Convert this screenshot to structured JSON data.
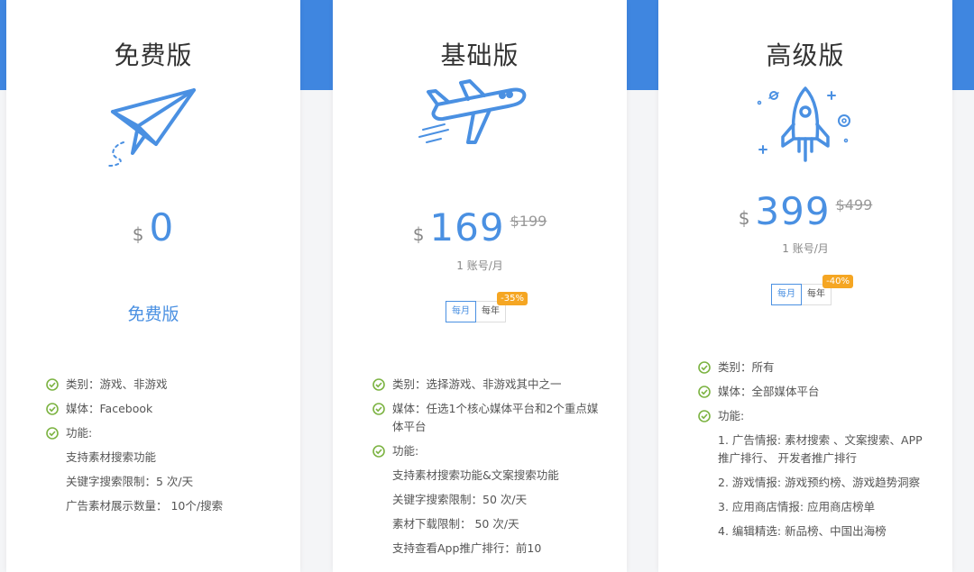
{
  "colors": {
    "accent": "#4a90e2",
    "band": "#3f86e0",
    "check_green": "#7cb342",
    "discount_orange": "#f5a623"
  },
  "plans": {
    "free": {
      "title": "免费版",
      "icon": "paper-plane-icon",
      "currency": "$",
      "price": "0",
      "label": "免费版",
      "features": [
        "类别：游戏、非游戏",
        "媒体：Facebook",
        "功能:"
      ],
      "sub_features": [
        "支持素材搜索功能",
        "关键字搜索限制：5 次/天",
        "广告素材展示数量： 10个/搜索"
      ]
    },
    "basic": {
      "title": "基础版",
      "icon": "airplane-icon",
      "currency": "$",
      "price": "169",
      "old_price": "$199",
      "per": "1 账号/月",
      "toggle": {
        "monthly": "每月",
        "yearly": "每年",
        "discount": "-35%"
      },
      "features": [
        "类别：选择游戏、非游戏其中之一",
        "媒体：任选1个核心媒体平台和2个重点媒体平台",
        "功能:"
      ],
      "sub_features": [
        "支持素材搜索功能&文案搜索功能",
        "关键字搜索限制：50 次/天",
        "素材下载限制： 50 次/天",
        "支持查看App推广排行：前10"
      ]
    },
    "pro": {
      "title": "高级版",
      "icon": "rocket-icon",
      "currency": "$",
      "price": "399",
      "old_price": "$499",
      "per": "1 账号/月",
      "toggle": {
        "monthly": "每月",
        "yearly": "每年",
        "discount": "-40%"
      },
      "features": [
        "类别：所有",
        "媒体：全部媒体平台",
        "功能:"
      ],
      "sub_features": [
        "1. 广告情报: 素材搜索 、文案搜索、APP推广排行、 开发者推广排行",
        "2. 游戏情报: 游戏预约榜、游戏趋势洞察",
        "3. 应用商店情报: 应用商店榜单",
        "4. 编辑精选: 新品榜、中国出海榜"
      ]
    }
  }
}
